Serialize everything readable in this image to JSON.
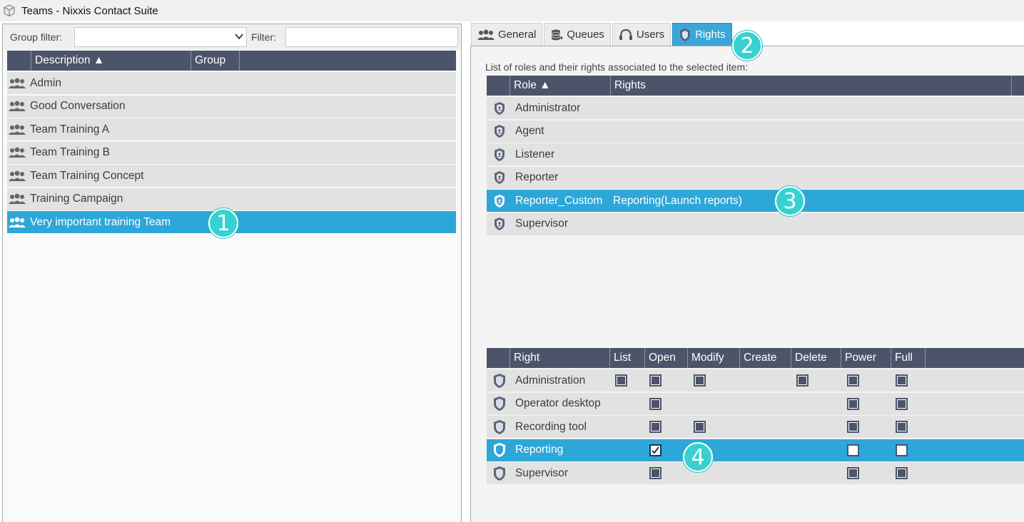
{
  "window": {
    "title": "Teams - Nixxis Contact Suite"
  },
  "filters": {
    "group_filter_label": "Group filter:",
    "filter_label": "Filter:",
    "group_filter_value": "",
    "filter_value": ""
  },
  "teams_grid": {
    "columns": [
      "Description ▲",
      "Group"
    ],
    "rows": [
      "Admin",
      "Good Conversation",
      "Team Training A",
      "Team Training B",
      "Team Training Concept",
      "Training Campaign",
      "Very important training Team"
    ],
    "selected_index": 6
  },
  "tabs": [
    {
      "label": "General",
      "icon": "team-icon"
    },
    {
      "label": "Queues",
      "icon": "queues-icon"
    },
    {
      "label": "Users",
      "icon": "headset-icon"
    },
    {
      "label": "Rights",
      "icon": "shield-icon"
    }
  ],
  "active_tab": "Rights",
  "roles": {
    "caption": "List of roles and their rights associated to the selected item:",
    "columns": [
      "Role ▲",
      "Rights"
    ],
    "rows": [
      {
        "role": "Administrator",
        "rights": ""
      },
      {
        "role": "Agent",
        "rights": ""
      },
      {
        "role": "Listener",
        "rights": ""
      },
      {
        "role": "Reporter",
        "rights": ""
      },
      {
        "role": "Reporter_Custom",
        "rights": "Reporting(Launch reports)"
      },
      {
        "role": "Supervisor",
        "rights": ""
      }
    ],
    "selected_index": 4
  },
  "rights": {
    "columns": [
      "Right",
      "List",
      "Open",
      "Modify",
      "Create",
      "Delete",
      "Power",
      "Full"
    ],
    "rows": [
      {
        "name": "Administration",
        "cells": {
          "List": "unchecked",
          "Open": "unchecked",
          "Modify": "unchecked",
          "Delete": "unchecked",
          "Power": "unchecked",
          "Full": "unchecked"
        }
      },
      {
        "name": "Operator desktop",
        "cells": {
          "Open": "unchecked",
          "Power": "unchecked",
          "Full": "unchecked"
        }
      },
      {
        "name": "Recording tool",
        "cells": {
          "Open": "unchecked",
          "Modify": "unchecked",
          "Power": "unchecked",
          "Full": "unchecked"
        }
      },
      {
        "name": "Reporting",
        "cells": {
          "Open": "checked",
          "Power": "unchecked",
          "Full": "unchecked"
        }
      },
      {
        "name": "Supervisor",
        "cells": {
          "Open": "unchecked",
          "Power": "unchecked",
          "Full": "unchecked"
        }
      }
    ],
    "selected_index": 3
  },
  "badges": [
    "1",
    "2",
    "3",
    "4"
  ],
  "colors": {
    "header": "#4b5468",
    "selected": "#2da7d8",
    "badge": "#38d1d1"
  }
}
